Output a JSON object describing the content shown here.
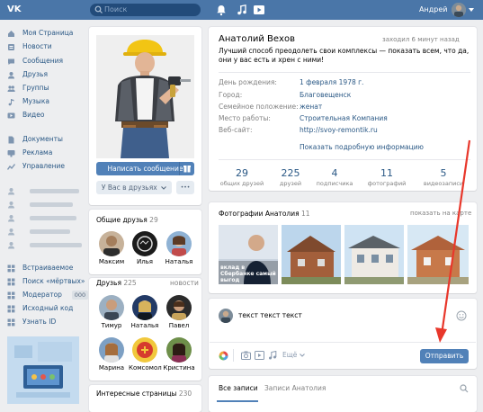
{
  "topbar": {
    "logo": "VK",
    "search_placeholder": "Поиск",
    "user_name": "Андрей"
  },
  "sidebar": {
    "items": [
      {
        "label": "Моя Страница",
        "icon": "home-icon"
      },
      {
        "label": "Новости",
        "icon": "news-icon"
      },
      {
        "label": "Сообщения",
        "icon": "messages-icon"
      },
      {
        "label": "Друзья",
        "icon": "friends-icon"
      },
      {
        "label": "Группы",
        "icon": "groups-icon"
      },
      {
        "label": "Музыка",
        "icon": "music-icon"
      },
      {
        "label": "Видео",
        "icon": "video-icon"
      },
      {
        "label": "Документы",
        "icon": "documents-icon"
      },
      {
        "label": "Реклама",
        "icon": "ads-icon"
      },
      {
        "label": "Управление",
        "icon": "manage-icon"
      },
      {
        "label": "Встраиваемое",
        "icon": "app-icon"
      },
      {
        "label": "Поиск «мёртвых»",
        "icon": "app-icon"
      },
      {
        "label": "Модератор",
        "icon": "app-icon",
        "badge": "000"
      },
      {
        "label": "Исходный код",
        "icon": "app-icon"
      },
      {
        "label": "Узнать ID",
        "icon": "app-icon"
      }
    ]
  },
  "profile": {
    "send_message": "Написать сообщение",
    "in_friends": "У Вас в друзьях",
    "more": "•••",
    "name": "Анатолий Вехов",
    "last_seen": "заходил 6 минут назад",
    "status": "Лучший способ преодолеть свои комплексы — показать всем, что да, они у вас есть и хрен с ними!",
    "info": [
      {
        "key": "День рождения:",
        "value": "1 февраля 1978 г."
      },
      {
        "key": "Город:",
        "value": "Благовещенск"
      },
      {
        "key": "Семейное положение:",
        "value": "женат"
      },
      {
        "key": "Место работы:",
        "value": "Строительная Компания"
      },
      {
        "key": "Веб-сайт:",
        "value": "http://svoy-remontik.ru"
      }
    ],
    "show_more": "Показать подробную информацию",
    "stats": [
      {
        "n": "29",
        "l": "общих друзей"
      },
      {
        "n": "225",
        "l": "друзей"
      },
      {
        "n": "4",
        "l": "подписчика"
      },
      {
        "n": "11",
        "l": "фотографий"
      },
      {
        "n": "5",
        "l": "видеозаписи"
      }
    ]
  },
  "mutual": {
    "title": "Общие друзья",
    "count": "29",
    "people": [
      "Максим",
      "Илья",
      "Наталья"
    ]
  },
  "friends": {
    "title": "Друзья",
    "count": "225",
    "news": "новости",
    "people": [
      "Тимур",
      "Наталья",
      "Павел",
      "Марина",
      "Комсомол",
      "Кристина"
    ]
  },
  "pages": {
    "title": "Интересные страницы",
    "count": "230"
  },
  "photos": {
    "title": "Фотографии Анатолия",
    "count": "11",
    "show_on_map": "показать на карте",
    "caption": "вклад в Сбербанке самый выгод"
  },
  "composer": {
    "text": "текст текст текст",
    "more": "Ещё",
    "send": "Отправить"
  },
  "wall_tabs": {
    "all": "Все записи",
    "own": "Записи Анатолия"
  },
  "colors": {
    "accent": "#4a76a8",
    "button": "#5181b8",
    "arrow": "#e8372b"
  }
}
